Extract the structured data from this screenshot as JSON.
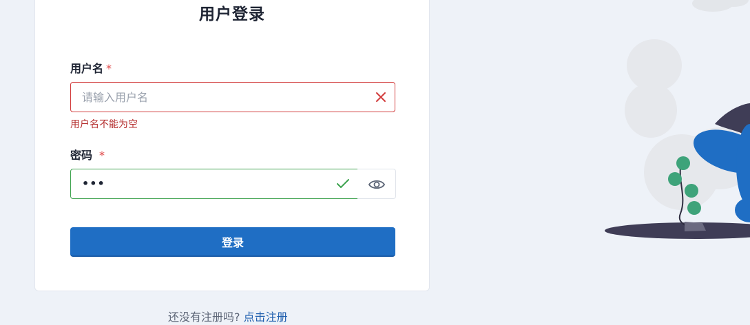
{
  "form": {
    "title": "用户登录",
    "username_label": "用户名",
    "username_placeholder": "请输入用户名",
    "username_error": "用户名不能为空",
    "password_label": "密码",
    "password_value": "•••",
    "required_mark": "*",
    "submit_label": "登录"
  },
  "footer": {
    "prompt": "还没有注册吗?",
    "register_link": "点击注册"
  },
  "colors": {
    "primary": "#1f6ec4",
    "error": "#d23c3c",
    "success": "#3ea34f",
    "background": "#eef2f8"
  },
  "icons": {
    "username_status": "close-icon",
    "password_status": "check-icon",
    "password_toggle": "eye-icon"
  }
}
